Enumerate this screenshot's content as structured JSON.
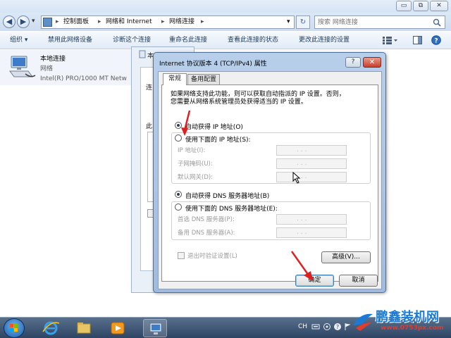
{
  "explorer": {
    "window_buttons": {
      "minimize": "▭",
      "maximize": "⧉",
      "close": "✕"
    },
    "nav": {
      "back": "◀",
      "forward": "▶",
      "history": "▾"
    },
    "breadcrumbs": [
      "控制面板",
      "网络和 Internet",
      "网络连接"
    ],
    "crumb_sep": "▸",
    "address_dropdown": "▾",
    "refresh": "↻",
    "search": {
      "placeholder": "搜索 网络连接",
      "icon": "search-icon"
    },
    "toolbar": [
      "组织 ▾",
      "禁用此网络设备",
      "诊断这个连接",
      "重命名此连接",
      "查看此连接的状态",
      "更改此连接的设置"
    ],
    "view_icons": [
      "view-options-icon",
      "preview-pane-icon",
      "help-icon"
    ],
    "connection": {
      "name": "本地连接",
      "network": "网络",
      "adapter": "Intel(R) PRO/1000 MT Netw"
    }
  },
  "background_dialog": {
    "title": "本",
    "partial_labels": [
      "网",
      "连",
      "此"
    ]
  },
  "dialog": {
    "title": "Internet 协议版本 4 (TCP/IPv4) 属性",
    "help": "?",
    "close": "✕",
    "tabs": [
      {
        "label": "常规",
        "active": true
      },
      {
        "label": "备用配置",
        "active": false
      }
    ],
    "description": [
      "如果网络支持此功能，则可以获取自动指派的 IP 设置。否则，",
      "您需要从网络系统管理员处获得适当的 IP 设置。"
    ],
    "ip_mode": {
      "auto_label": "自动获得 IP 地址(O)",
      "manual_label": "使用下面的 IP 地址(S):",
      "selected": "auto"
    },
    "ip_fields": [
      {
        "label": "IP 地址(I):",
        "value": ". . ."
      },
      {
        "label": "子网掩码(U):",
        "value": ". . ."
      },
      {
        "label": "默认网关(D):",
        "value": ". . ."
      }
    ],
    "dns_mode": {
      "auto_label": "自动获得 DNS 服务器地址(B)",
      "manual_label": "使用下面的 DNS 服务器地址(E):",
      "selected": "auto"
    },
    "dns_fields": [
      {
        "label": "首选 DNS 服务器(P):",
        "value": ". . ."
      },
      {
        "label": "备用 DNS 服务器(A):",
        "value": ". . ."
      }
    ],
    "validate": {
      "label": "退出时验证设置(L)",
      "checked": false
    },
    "advanced_label": "高级(V)...",
    "ok_label": "确定",
    "cancel_label": "取消"
  },
  "taskbar": {
    "icons": [
      "start-orb-icon",
      "internet-explorer-icon",
      "file-explorer-icon",
      "media-player-icon",
      "network-connections-icon"
    ],
    "tray": {
      "lang": "CH"
    }
  },
  "watermark": {
    "brand": "鹏鑫装机网",
    "url": "www.0753px.com"
  },
  "colors": {
    "accent": "#1a7ad6",
    "arrow": "#e02020",
    "titlebar": "#b8cfea"
  }
}
